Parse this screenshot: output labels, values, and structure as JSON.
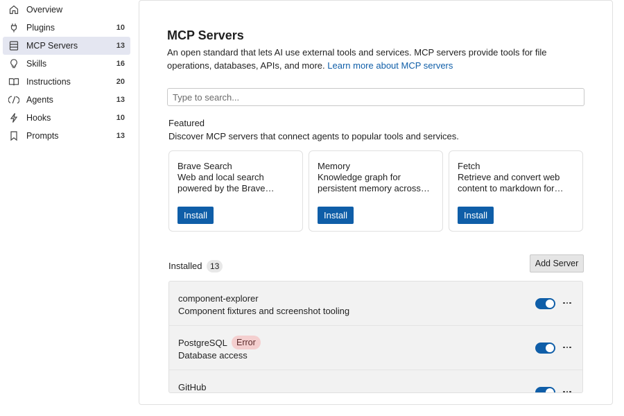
{
  "sidebar": {
    "items": [
      {
        "label": "Overview",
        "count": "",
        "icon": "home-icon",
        "active": false
      },
      {
        "label": "Plugins",
        "count": "10",
        "icon": "plug-icon",
        "active": false
      },
      {
        "label": "MCP Servers",
        "count": "13",
        "icon": "server-icon",
        "active": true
      },
      {
        "label": "Skills",
        "count": "16",
        "icon": "lightbulb-icon",
        "active": false
      },
      {
        "label": "Instructions",
        "count": "20",
        "icon": "book-icon",
        "active": false
      },
      {
        "label": "Agents",
        "count": "13",
        "icon": "agent-icon",
        "active": false
      },
      {
        "label": "Hooks",
        "count": "10",
        "icon": "lightning-icon",
        "active": false
      },
      {
        "label": "Prompts",
        "count": "13",
        "icon": "bookmark-icon",
        "active": false
      }
    ]
  },
  "main": {
    "title": "MCP Servers",
    "description": "An open standard that lets AI use external tools and services. MCP servers provide tools for file operations, databases, APIs, and more.",
    "learn_more_link": "Learn more about MCP servers",
    "search_placeholder": "Type to search...",
    "featured": {
      "title": "Featured",
      "subtitle": "Discover MCP servers that connect agents to popular tools and services.",
      "cards": [
        {
          "name": "Brave Search",
          "desc_line1": "Web and local search",
          "desc_line2": "powered by the Brave…",
          "button": "Install"
        },
        {
          "name": "Memory",
          "desc_line1": "Knowledge graph for",
          "desc_line2": "persistent memory across…",
          "button": "Install"
        },
        {
          "name": "Fetch",
          "desc_line1": "Retrieve and convert web",
          "desc_line2": "content to markdown for…",
          "button": "Install"
        }
      ]
    },
    "installed": {
      "label": "Installed",
      "count": "13",
      "add_button": "Add Server",
      "servers": [
        {
          "name": "component-explorer",
          "description": "Component fixtures and screenshot tooling",
          "badge": "",
          "enabled": true
        },
        {
          "name": "PostgreSQL",
          "description": "Database access",
          "badge": "Error",
          "enabled": true
        },
        {
          "name": "GitHub",
          "description": "",
          "badge": "",
          "enabled": true
        }
      ]
    }
  },
  "colors": {
    "accent": "#0f5ea8",
    "active_nav_bg": "#e4e6f1",
    "error_badge_bg": "#f4cfcf"
  }
}
